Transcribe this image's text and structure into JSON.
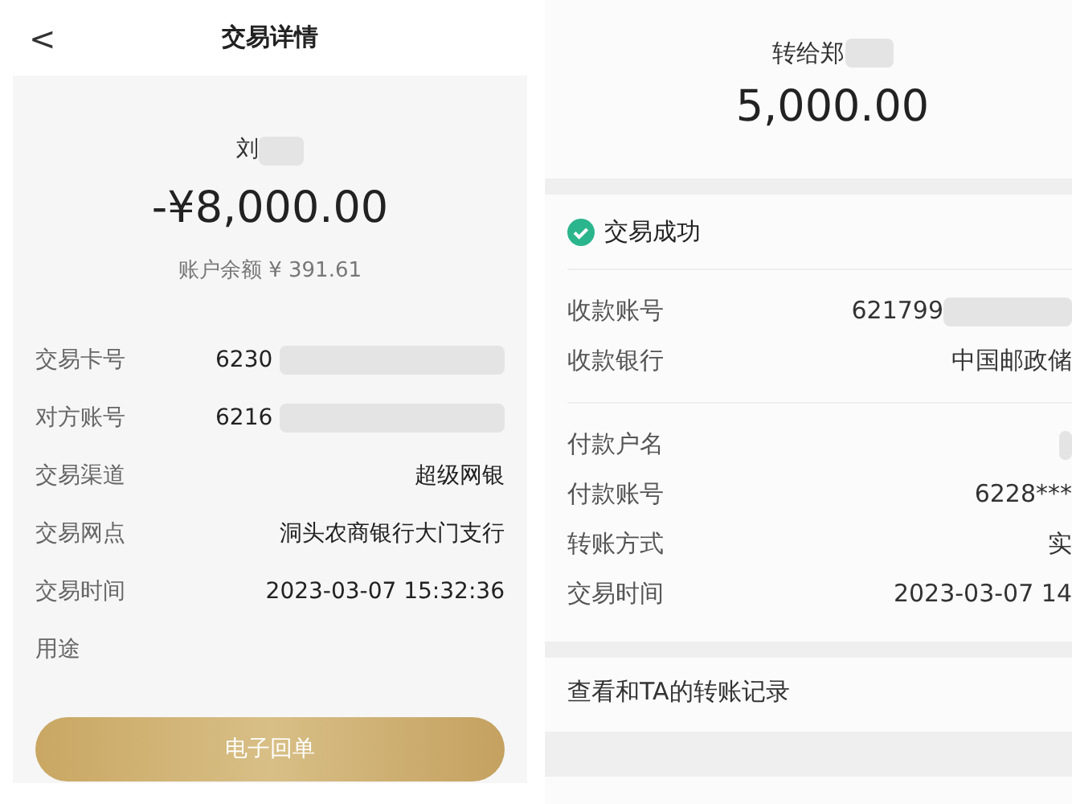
{
  "left": {
    "title": "交易详情",
    "back": "<",
    "name": "刘",
    "amount": "-¥8,000.00",
    "balance": "账户余额 ¥ 391.61",
    "rows": [
      {
        "label": "交易卡号",
        "value": "6230",
        "redacted": true
      },
      {
        "label": "对方账号",
        "value": "6216",
        "redacted": true
      },
      {
        "label": "交易渠道",
        "value": "超级网银",
        "redacted": false
      },
      {
        "label": "交易网点",
        "value": "洞头农商银行大门支行",
        "redacted": false
      },
      {
        "label": "交易时间",
        "value": "2023-03-07 15:32:36",
        "redacted": false
      },
      {
        "label": "用途",
        "redacted": false
      }
    ],
    "button": "电子回单"
  },
  "right": {
    "recipient": "转给郑",
    "amount": "5,000.00",
    "status": "交易成功",
    "groups": [
      [
        {
          "label": "收款账号",
          "value": "621799",
          "redacted": true
        },
        {
          "label": "收款银行",
          "value": "中国邮政储",
          "redacted": false
        }
      ],
      [
        {
          "label": "付款户名",
          "redacted": true
        },
        {
          "label": "付款账号",
          "value": "6228***",
          "redacted": false
        },
        {
          "label": "转账方式",
          "value": "实",
          "redacted": false
        },
        {
          "label": "交易时间",
          "value": "2023-03-07 14",
          "redacted": false
        }
      ]
    ],
    "link": "查看和TA的转账记录"
  }
}
